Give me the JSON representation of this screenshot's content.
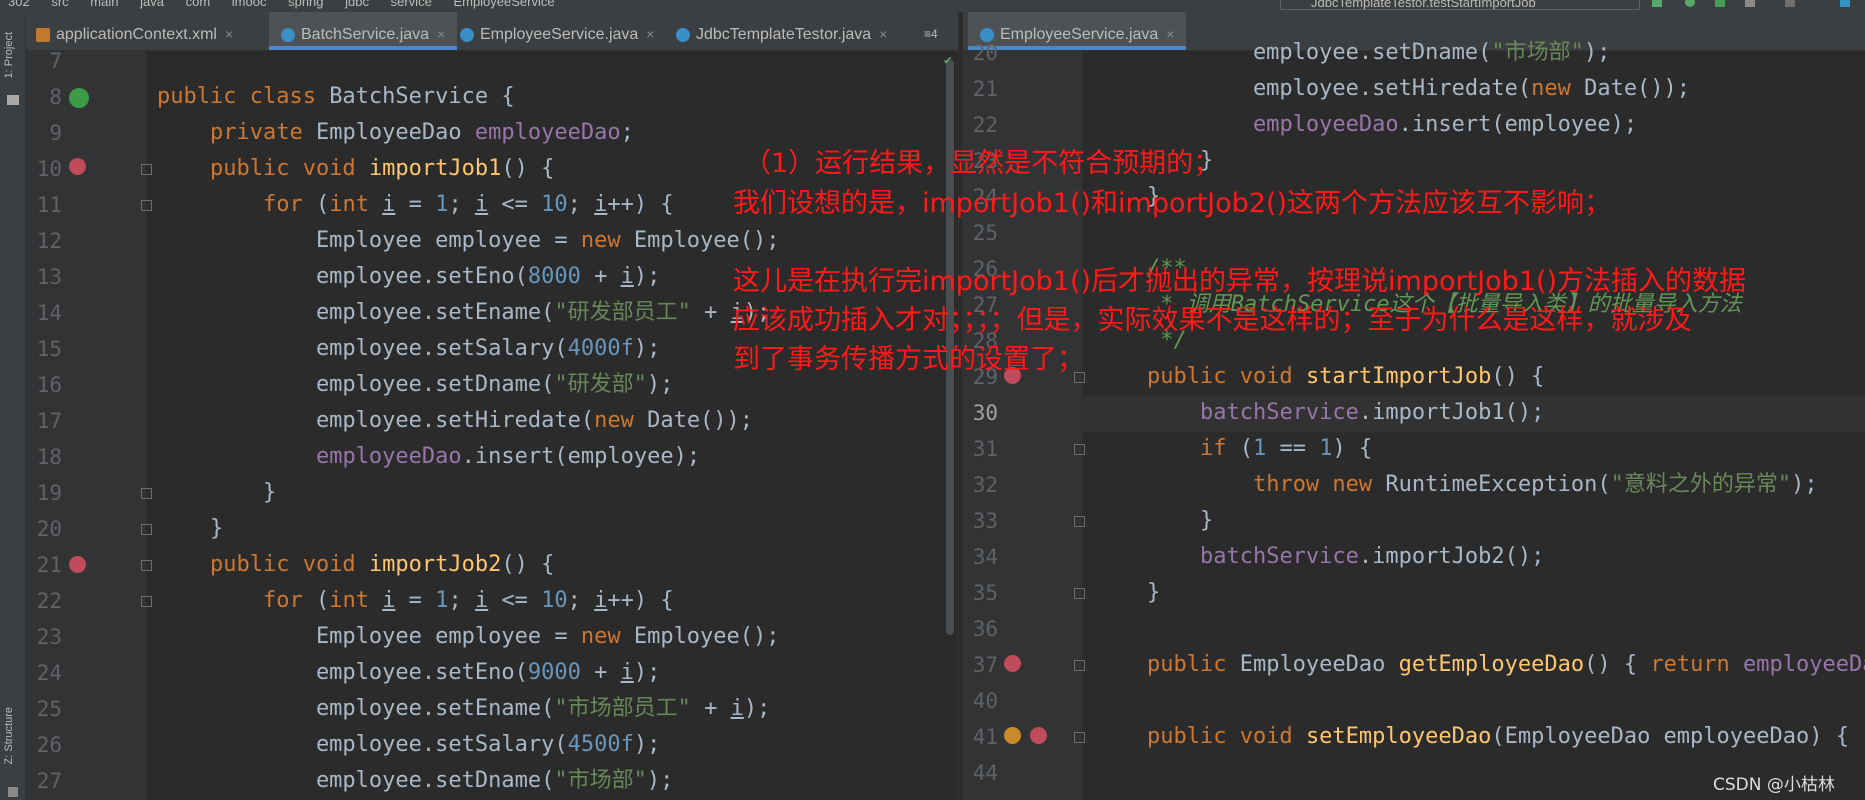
{
  "breadcrumb": [
    "302",
    "src",
    "main",
    "java",
    "com",
    "imooc",
    "spring",
    "jdbc",
    "service",
    "EmployeeService"
  ],
  "run_config": "JdbcTemplateTestor.testStartImportJob",
  "side_tabs": {
    "project": "1: Project",
    "structure": "Z: Structure"
  },
  "left_tabs": [
    {
      "label": "applicationContext.xml",
      "close": "×"
    },
    {
      "label": "BatchService.java",
      "close": "×"
    },
    {
      "label": "EmployeeService.java",
      "close": "×"
    },
    {
      "label": "JdbcTemplateTestor.java",
      "close": "×"
    }
  ],
  "left_tab_overflow": "≡4",
  "right_tabs": [
    {
      "label": "EmployeeService.java",
      "close": "×"
    }
  ],
  "left_line_numbers": [
    "7",
    "8",
    "9",
    "10",
    "11",
    "12",
    "13",
    "14",
    "15",
    "16",
    "17",
    "18",
    "19",
    "20",
    "21",
    "22",
    "23",
    "24",
    "25",
    "26",
    "27"
  ],
  "right_line_numbers": [
    "20",
    "21",
    "22",
    "23",
    "24",
    "25",
    "26",
    "27",
    "28",
    "29",
    "30",
    "31",
    "32",
    "33",
    "34",
    "35",
    "36",
    "37",
    "40",
    "41",
    "44"
  ],
  "left_code": [
    "",
    "public class BatchService {",
    "    private EmployeeDao employeeDao;",
    "    public void importJob1() {",
    "        for (int i = 1; i <= 10; i++) {",
    "            Employee employee = new Employee();",
    "            employee.setEno(8000 + i);",
    "            employee.setEname(\"研发部员工\" + i);",
    "            employee.setSalary(4000f);",
    "            employee.setDname(\"研发部\");",
    "            employee.setHiredate(new Date());",
    "            employeeDao.insert(employee);",
    "        }",
    "    }",
    "    public void importJob2() {",
    "        for (int i = 1; i <= 10; i++) {",
    "            Employee employee = new Employee();",
    "            employee.setEno(9000 + i);",
    "            employee.setEname(\"市场部员工\" + i);",
    "            employee.setSalary(4500f);",
    "            employee.setDname(\"市场部\");"
  ],
  "right_code": [
    "            employee.setDname(\"市场部\");",
    "            employee.setHiredate(new Date());",
    "            employeeDao.insert(employee);",
    "        }",
    "    }",
    "",
    "    /**",
    "     * 调用BatchService这个【批量导入类】的批量导入方法",
    "     */",
    "    public void startImportJob() {",
    "        batchService.importJob1();",
    "        if (1 == 1) {",
    "            throw new RuntimeException(\"意料之外的异常\");",
    "        }",
    "        batchService.importJob2();",
    "    }",
    "",
    "    public EmployeeDao getEmployeeDao() { return employeeDao; }",
    "",
    "    public void setEmployeeDao(EmployeeDao employeeDao) {",
    ""
  ],
  "annotations": [
    "（1）运行结果，显然是不符合预期的；",
    "我们设想的是，importJob1()和importJob2()这两个方法应该互不影响；",
    "这儿是在执行完importJob1()后才抛出的异常，按理说importJob1()方法插入的数据",
    "应该成功插入才对；；；；但是，实际效果不是这样的；至于为什么是这样，就涉及",
    "到了事务传播方式的设置了；"
  ],
  "watermark": "CSDN @小枯林",
  "colors": {
    "bg": "#2b2b2b",
    "keyword": "#cc7832",
    "string": "#6a8759",
    "number": "#6897bb",
    "field": "#9876aa",
    "method": "#ffc66d",
    "annotation": "#ff1a1a"
  }
}
